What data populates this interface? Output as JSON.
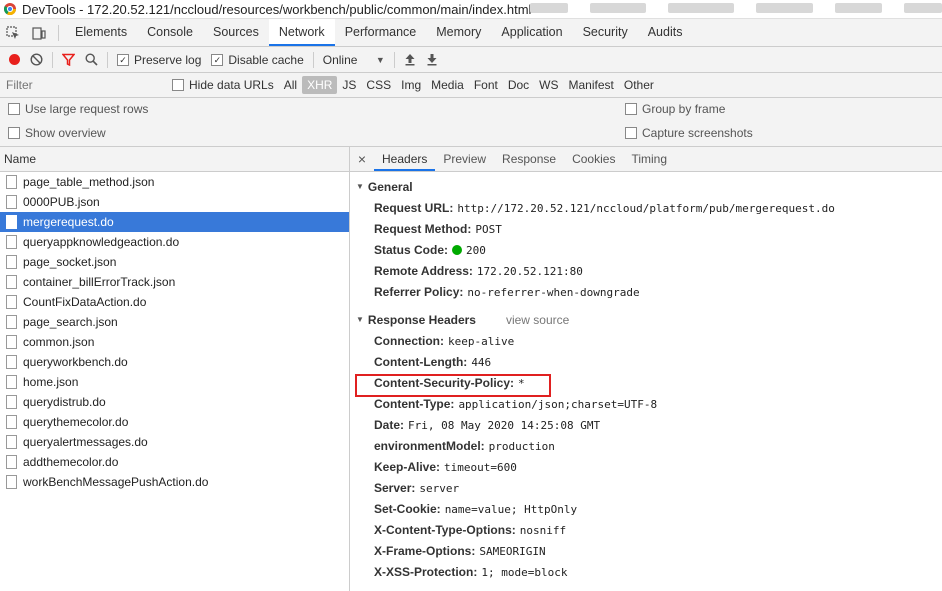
{
  "window": {
    "title": "DevTools - 172.20.52.121/nccloud/resources/workbench/public/common/main/index.html"
  },
  "tabs": [
    "Elements",
    "Console",
    "Sources",
    "Network",
    "Performance",
    "Memory",
    "Application",
    "Security",
    "Audits"
  ],
  "active_tab": "Network",
  "toolbar": {
    "preserve_log": "Preserve log",
    "disable_cache": "Disable cache",
    "throttle": "Online",
    "throttle_arrow": "▼"
  },
  "filter": {
    "placeholder": "Filter",
    "hide_data_urls": "Hide data URLs",
    "types": [
      "All",
      "XHR",
      "JS",
      "CSS",
      "Img",
      "Media",
      "Font",
      "Doc",
      "WS",
      "Manifest",
      "Other"
    ],
    "active_type": "XHR"
  },
  "options": {
    "large_rows": "Use large request rows",
    "show_overview": "Show overview",
    "group_by_frame": "Group by frame",
    "capture_screenshots": "Capture screenshots"
  },
  "requests": {
    "header": "Name",
    "items": [
      "page_table_method.json",
      "0000PUB.json",
      "mergerequest.do",
      "queryappknowledgeaction.do",
      "page_socket.json",
      "container_billErrorTrack.json",
      "CountFixDataAction.do",
      "page_search.json",
      "common.json",
      "queryworkbench.do",
      "home.json",
      "querydistrub.do",
      "querythemecolor.do",
      "queryalertmessages.do",
      "addthemecolor.do",
      "workBenchMessagePushAction.do"
    ],
    "selected": "mergerequest.do"
  },
  "detail": {
    "close": "×",
    "tabs": [
      "Headers",
      "Preview",
      "Response",
      "Cookies",
      "Timing"
    ],
    "active_tab": "Headers",
    "general_title": "General",
    "general": [
      {
        "name": "Request URL:",
        "value": "http://172.20.52.121/nccloud/platform/pub/mergerequest.do"
      },
      {
        "name": "Request Method:",
        "value": "POST"
      },
      {
        "name": "Status Code:",
        "value": "200"
      },
      {
        "name": "Remote Address:",
        "value": "172.20.52.121:80"
      },
      {
        "name": "Referrer Policy:",
        "value": "no-referrer-when-downgrade"
      }
    ],
    "response_title": "Response Headers",
    "view_source": "view source",
    "response_headers": [
      {
        "name": "Connection:",
        "value": "keep-alive"
      },
      {
        "name": "Content-Length:",
        "value": "446"
      },
      {
        "name": "Content-Security-Policy:",
        "value": "*"
      },
      {
        "name": "Content-Type:",
        "value": "application/json;charset=UTF-8"
      },
      {
        "name": "Date:",
        "value": "Fri, 08 May 2020 14:25:08 GMT"
      },
      {
        "name": "environmentModel:",
        "value": "production"
      },
      {
        "name": "Keep-Alive:",
        "value": "timeout=600"
      },
      {
        "name": "Server:",
        "value": "server"
      },
      {
        "name": "Set-Cookie:",
        "value": "name=value; HttpOnly"
      },
      {
        "name": "X-Content-Type-Options:",
        "value": "nosniff"
      },
      {
        "name": "X-Frame-Options:",
        "value": "SAMEORIGIN"
      },
      {
        "name": "X-XSS-Protection:",
        "value": "1; mode=block"
      }
    ],
    "status_color": "#00aa00",
    "highlight_color": "#e02020"
  },
  "colors": {
    "accent": "#1a73e8",
    "selection": "#3879d9",
    "record": "#e8201c"
  }
}
